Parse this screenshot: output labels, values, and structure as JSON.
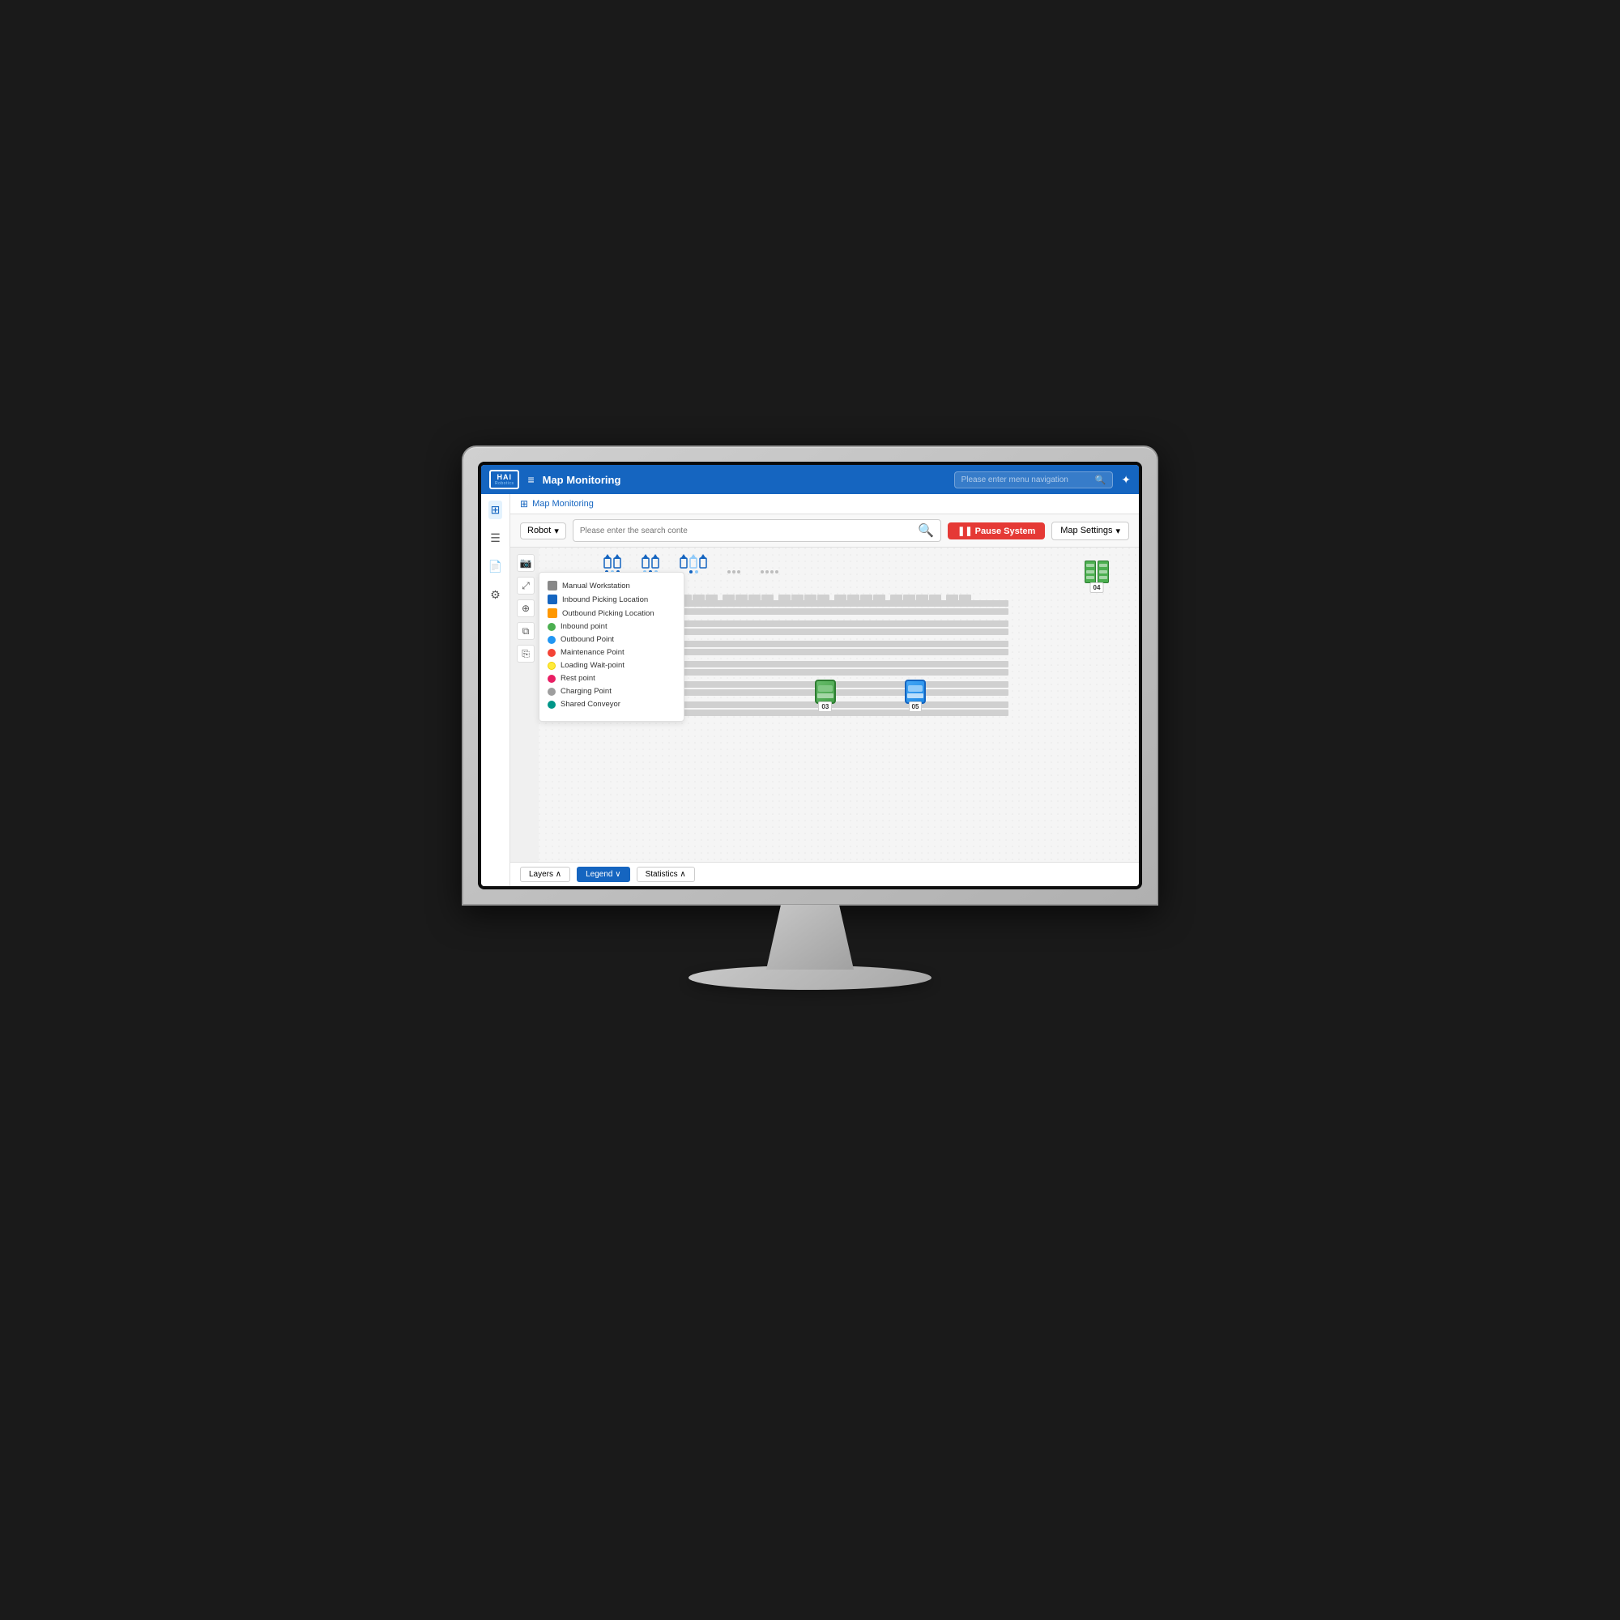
{
  "topbar": {
    "logo_hai": "HAI",
    "logo_sub": "Robotics",
    "hamburger": "≡",
    "title": "Map Monitoring",
    "search_placeholder": "Please enter menu navigation",
    "settings_icon": "✦"
  },
  "breadcrumb": {
    "icon": "⊞",
    "text": "Map Monitoring"
  },
  "toolbar": {
    "robot_label": "Robot",
    "search_placeholder": "Please enter the search conte",
    "pause_label": "❚❚ Pause System",
    "map_settings_label": "Map Settings"
  },
  "legend": {
    "items": [
      {
        "type": "square_gray",
        "color": "#888",
        "label": "Manual Workstation"
      },
      {
        "type": "square_blue",
        "color": "#1565c0",
        "label": "Inbound Picking Location"
      },
      {
        "type": "square_orange",
        "color": "#ff9800",
        "label": "Outbound Picking Location"
      },
      {
        "type": "circle_green",
        "color": "#4caf50",
        "label": "Inbound point"
      },
      {
        "type": "circle_blue",
        "color": "#2196f3",
        "label": "Outbound Point"
      },
      {
        "type": "circle_red",
        "color": "#f44336",
        "label": "Maintenance Point"
      },
      {
        "type": "circle_yellow",
        "color": "#ffeb3b",
        "label": "Loading Wait-point"
      },
      {
        "type": "circle_pink",
        "color": "#e91e63",
        "label": "Rest point"
      },
      {
        "type": "circle_gray",
        "color": "#9e9e9e",
        "label": "Charging Point"
      },
      {
        "type": "circle_teal",
        "color": "#009688",
        "label": "Shared Conveyor"
      }
    ]
  },
  "bottom": {
    "layers_label": "Layers ∧",
    "legend_label": "Legend ∨",
    "statistics_label": "Statistics ∧"
  },
  "robots": [
    {
      "id": "03",
      "color": "green",
      "x": "46%",
      "y": "40%"
    },
    {
      "id": "05",
      "color": "blue",
      "x": "60%",
      "y": "40%"
    },
    {
      "id": "04",
      "color": "green",
      "x": "88%",
      "y": "5%"
    }
  ]
}
